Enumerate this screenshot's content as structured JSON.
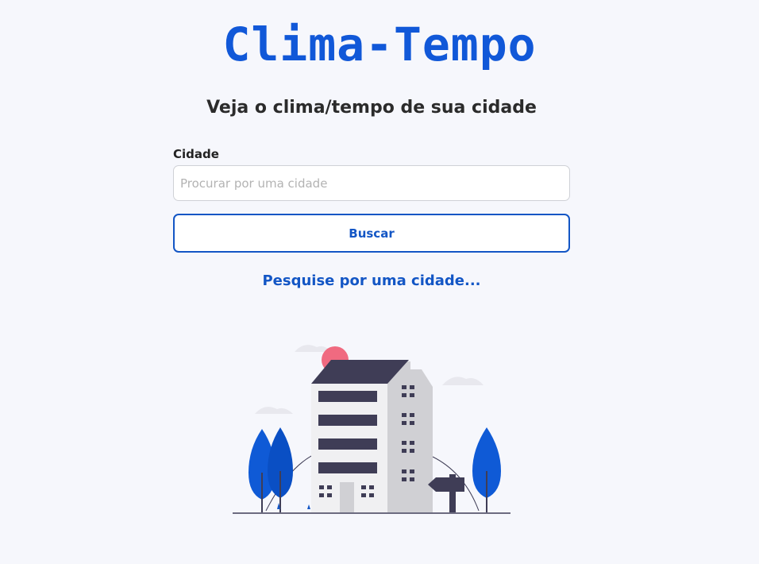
{
  "app": {
    "logo_text": "Clima-Tempo"
  },
  "main": {
    "subtitle": "Veja o clima/tempo de sua cidade",
    "city_label": "Cidade",
    "search_placeholder": "Procurar por uma cidade",
    "search_value": "",
    "search_button_label": "Buscar",
    "hint_text": "Pesquise por uma cidade..."
  },
  "colors": {
    "brand_blue": "#1158d8",
    "button_blue": "#1356c5",
    "background": "#f6f7fc",
    "building_dark": "#3f3d56",
    "sun_pink": "#f06a80"
  },
  "illustration": {
    "icon": "city-building-illustration"
  }
}
